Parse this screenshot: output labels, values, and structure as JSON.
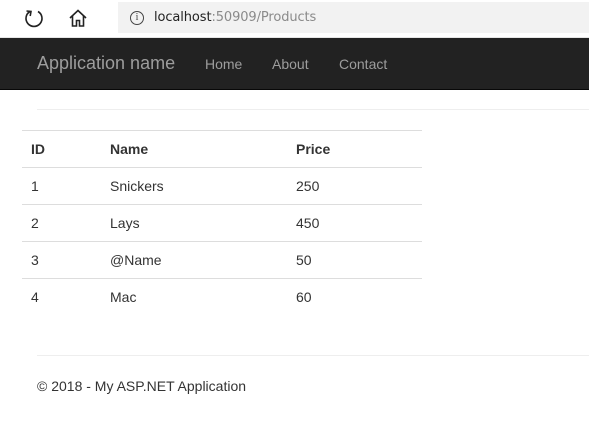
{
  "browser": {
    "url_host": "localhost",
    "url_rest": ":50909/Products",
    "info_glyph": "i",
    "icons": [
      "refresh-icon",
      "home-icon",
      "info-icon"
    ]
  },
  "navbar": {
    "brand": "Application name",
    "links": [
      {
        "label": "Home"
      },
      {
        "label": "About"
      },
      {
        "label": "Contact"
      }
    ],
    "background": "#222222",
    "link_color": "#9d9d9d"
  },
  "table": {
    "headers": [
      "ID",
      "Name",
      "Price"
    ],
    "rows": [
      [
        "1",
        "Snickers",
        "250"
      ],
      [
        "2",
        "Lays",
        "450"
      ],
      [
        "3",
        "@Name",
        "50"
      ],
      [
        "4",
        "Mac",
        "60"
      ]
    ]
  },
  "footer": {
    "text": "© 2018 - My ASP.NET Application"
  }
}
